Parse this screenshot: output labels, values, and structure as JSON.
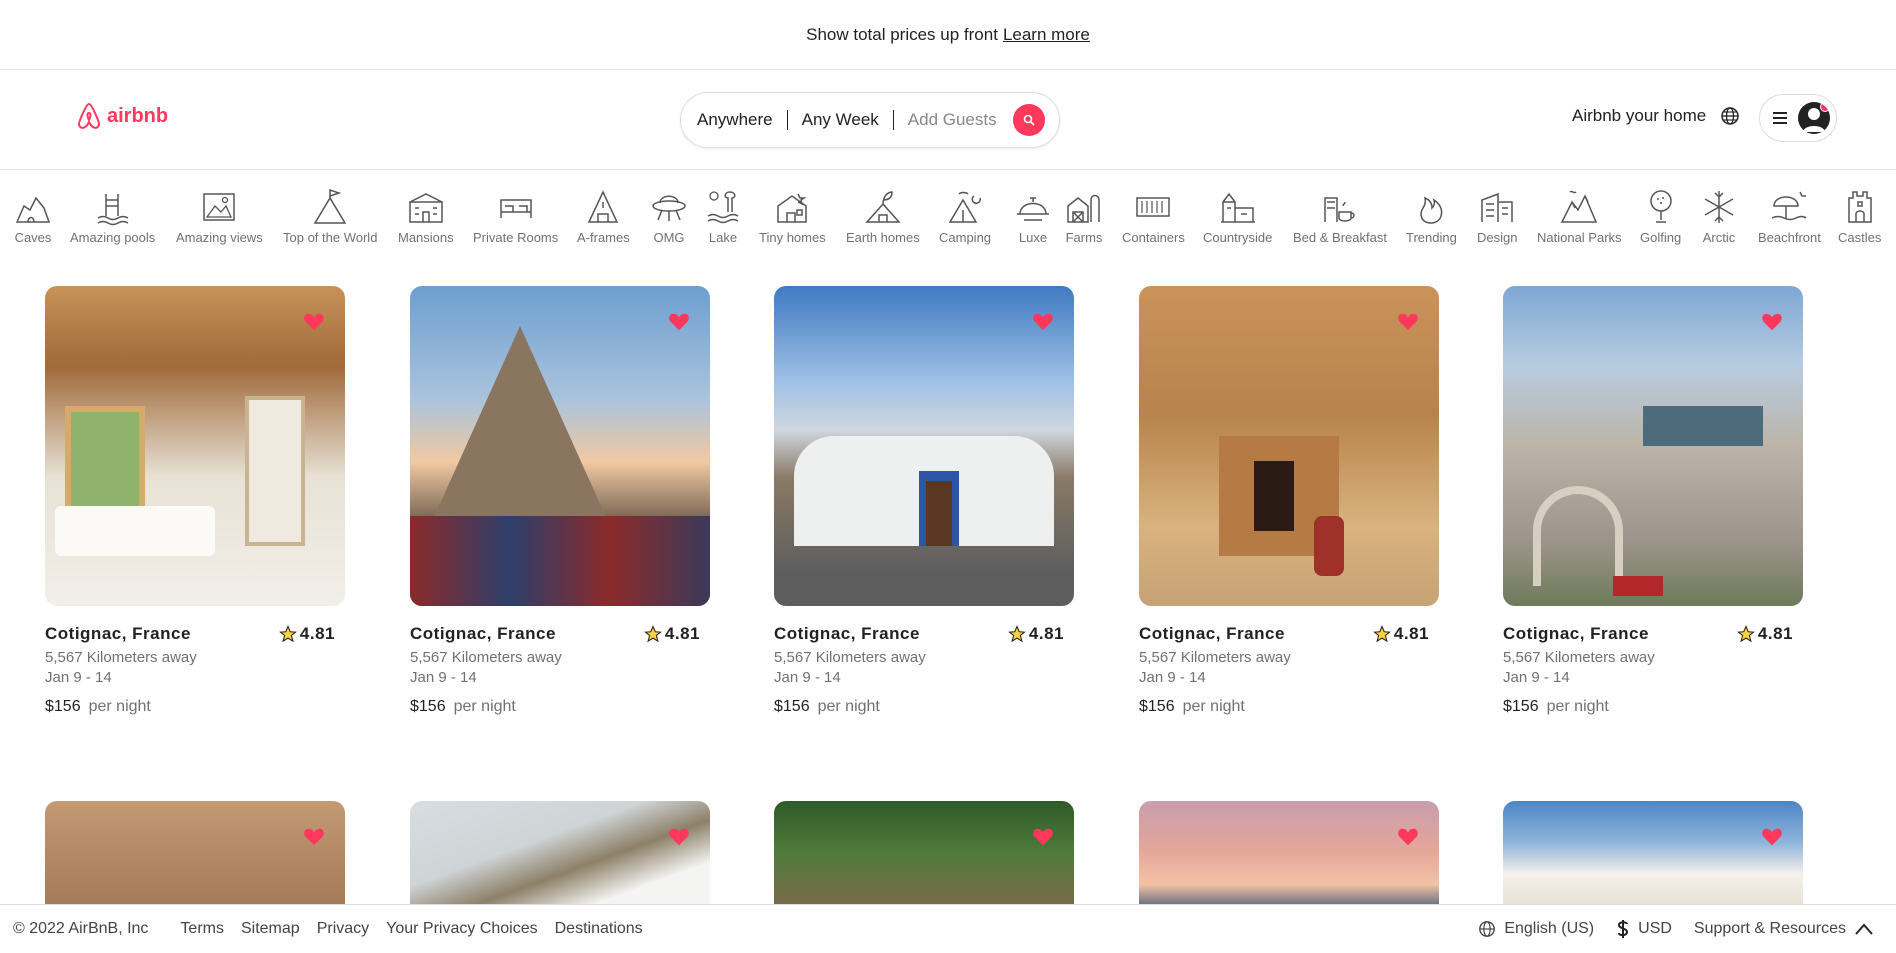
{
  "banner": {
    "text": "Show total prices up front",
    "link": "Learn more"
  },
  "header": {
    "logo_text": "airbnb",
    "search": {
      "where": "Anywhere",
      "when": "Any Week",
      "guests": "Add Guests"
    },
    "host_link": "Airbnb your home"
  },
  "categories": [
    {
      "label": "Caves",
      "icon": "caves-icon"
    },
    {
      "label": "Amazing pools",
      "icon": "pool-icon"
    },
    {
      "label": "Amazing views",
      "icon": "views-icon"
    },
    {
      "label": "Top of the World",
      "icon": "flag-peak-icon"
    },
    {
      "label": "Mansions",
      "icon": "mansion-icon"
    },
    {
      "label": "Private Rooms",
      "icon": "bed-icon"
    },
    {
      "label": "A-frames",
      "icon": "a-frame-icon"
    },
    {
      "label": "OMG",
      "icon": "ufo-icon"
    },
    {
      "label": "Lake",
      "icon": "lake-icon"
    },
    {
      "label": "Tiny homes",
      "icon": "tiny-home-icon"
    },
    {
      "label": "Earth homes",
      "icon": "earth-home-icon"
    },
    {
      "label": "Camping",
      "icon": "camping-icon"
    },
    {
      "label": "Luxe",
      "icon": "cloche-icon"
    },
    {
      "label": "Farms",
      "icon": "barn-icon"
    },
    {
      "label": "Containers",
      "icon": "container-icon"
    },
    {
      "label": "Countryside",
      "icon": "countryside-icon"
    },
    {
      "label": "Bed & Breakfast",
      "icon": "bed-breakfast-icon"
    },
    {
      "label": "Trending",
      "icon": "flame-icon"
    },
    {
      "label": "Design",
      "icon": "design-icon"
    },
    {
      "label": "National Parks",
      "icon": "mountains-icon"
    },
    {
      "label": "Golfing",
      "icon": "golf-icon"
    },
    {
      "label": "Arctic",
      "icon": "snowflake-icon"
    },
    {
      "label": "Beachfront",
      "icon": "beach-umbrella-icon"
    },
    {
      "label": "Castles",
      "icon": "castle-icon"
    }
  ],
  "listings": [
    {
      "location": "Cotignac, France",
      "rating": "4.81",
      "distance": "5,567 Kilometers away",
      "dates": "Jan 9 - 14",
      "price": "$156",
      "per": "per night"
    },
    {
      "location": "Cotignac, France",
      "rating": "4.81",
      "distance": "5,567 Kilometers away",
      "dates": "Jan 9 - 14",
      "price": "$156",
      "per": "per night"
    },
    {
      "location": "Cotignac, France",
      "rating": "4.81",
      "distance": "5,567 Kilometers away",
      "dates": "Jan 9 - 14",
      "price": "$156",
      "per": "per night"
    },
    {
      "location": "Cotignac, France",
      "rating": "4.81",
      "distance": "5,567 Kilometers away",
      "dates": "Jan 9 - 14",
      "price": "$156",
      "per": "per night"
    },
    {
      "location": "Cotignac, France",
      "rating": "4.81",
      "distance": "5,567 Kilometers away",
      "dates": "Jan 9 - 14",
      "price": "$156",
      "per": "per night"
    }
  ],
  "footer": {
    "copyright": "© 2022 AirBnB, Inc",
    "links": [
      "Terms",
      "Sitemap",
      "Privacy",
      "Your Privacy Choices",
      "Destinations"
    ],
    "language": "English (US)",
    "currency": "USD",
    "support": "Support & Resources"
  },
  "colors": {
    "brand": "#ff385c"
  }
}
